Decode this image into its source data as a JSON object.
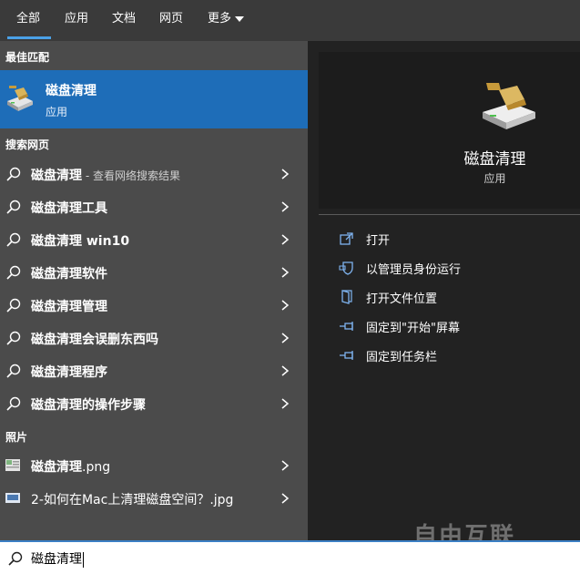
{
  "tabs": [
    "全部",
    "应用",
    "文档",
    "网页",
    "更多"
  ],
  "sections": {
    "best_match": "最佳匹配",
    "search_web": "搜索网页",
    "photos": "照片"
  },
  "best_match": {
    "title": "磁盘清理",
    "subtitle": "应用"
  },
  "web_results": [
    {
      "text": "磁盘清理",
      "suffix": " - 查看网络搜索结果"
    },
    {
      "text": "磁盘清理工具",
      "suffix": ""
    },
    {
      "text": "磁盘清理 win10",
      "suffix": ""
    },
    {
      "text": "磁盘清理软件",
      "suffix": ""
    },
    {
      "text": "磁盘清理管理",
      "suffix": ""
    },
    {
      "text": "磁盘清理会误删东西吗",
      "suffix": ""
    },
    {
      "text": "磁盘清理程序",
      "suffix": ""
    },
    {
      "text": "磁盘清理的操作步骤",
      "suffix": ""
    }
  ],
  "photo_results": [
    {
      "bold": "磁盘清理",
      "rest": ".png"
    },
    {
      "bold": "",
      "rest": "2-如何在Mac上清理磁盘空间？.jpg"
    }
  ],
  "detail": {
    "title": "磁盘清理",
    "subtitle": "应用",
    "actions": [
      "打开",
      "以管理员身份运行",
      "打开文件位置",
      "固定到\"开始\"屏幕",
      "固定到任务栏"
    ]
  },
  "search": {
    "value": "磁盘清理"
  },
  "watermark": "自由互联",
  "colors": {
    "accent": "#1e6db8",
    "tab_underline": "#4aa0e6",
    "left_bg": "#4b4b4b",
    "right_bg": "#222222"
  }
}
